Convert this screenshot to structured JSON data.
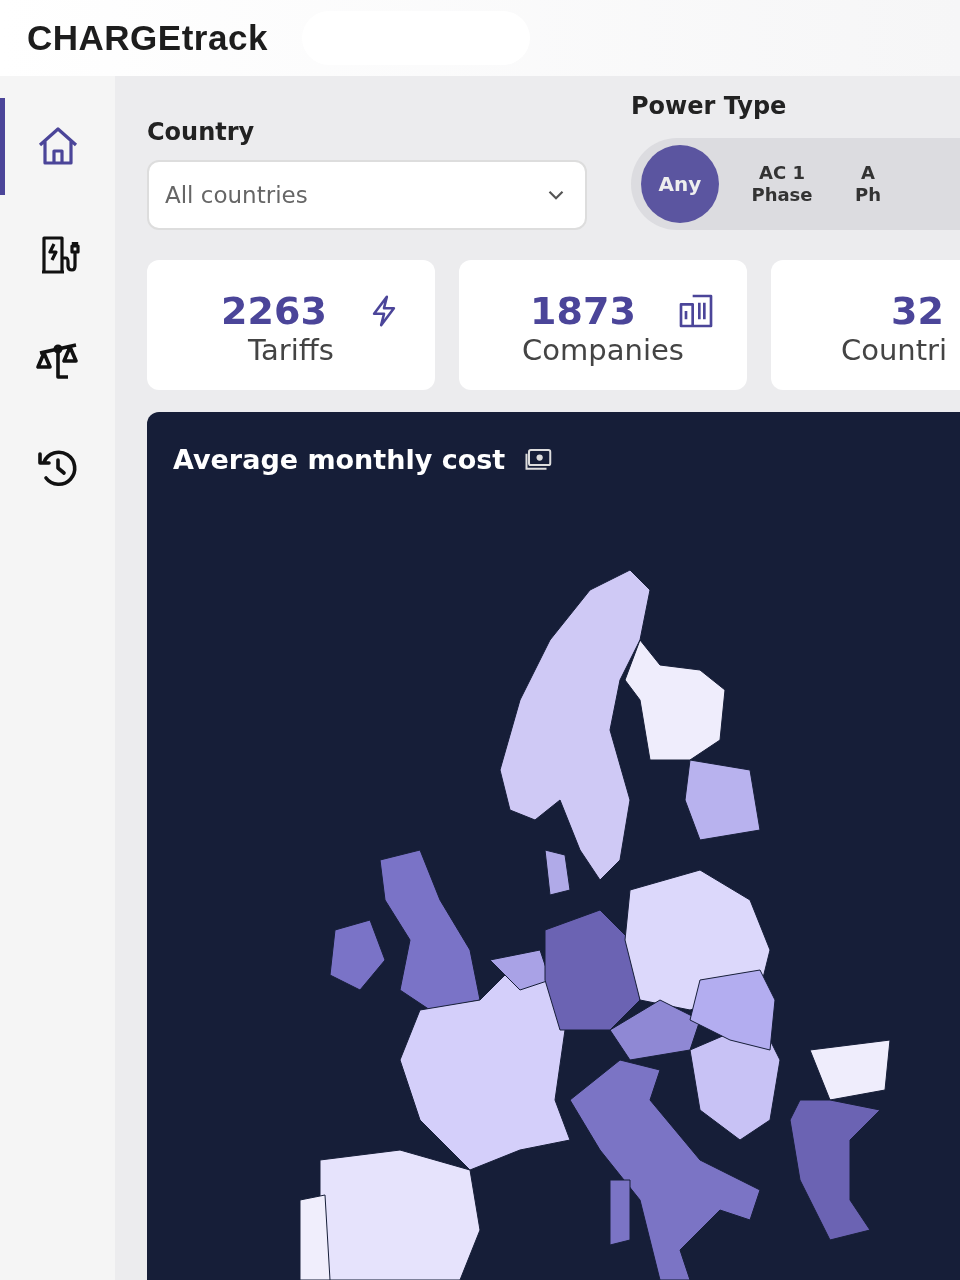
{
  "app": {
    "logo": "CHARGEtrack"
  },
  "sidebar": {
    "items": [
      {
        "kind": "home",
        "selected": true
      },
      {
        "kind": "charger",
        "selected": false
      },
      {
        "kind": "compare",
        "selected": false
      },
      {
        "kind": "history",
        "selected": false
      }
    ]
  },
  "filters": {
    "country": {
      "label": "Country",
      "value": "All countries"
    },
    "power_type": {
      "label": "Power Type",
      "options": [
        {
          "lines": [
            "Any"
          ],
          "selected": true
        },
        {
          "lines": [
            "AC 1",
            "Phase"
          ],
          "selected": false
        },
        {
          "lines": [
            "A",
            "Ph"
          ],
          "selected": false
        }
      ]
    }
  },
  "stats": [
    {
      "value": "2263",
      "label": "Tariffs",
      "kind": "bolt"
    },
    {
      "value": "1873",
      "label": "Companies",
      "kind": "building"
    },
    {
      "value": "32",
      "label": "Countri",
      "kind": "none"
    }
  ],
  "map_panel": {
    "title": "Average monthly cost"
  }
}
